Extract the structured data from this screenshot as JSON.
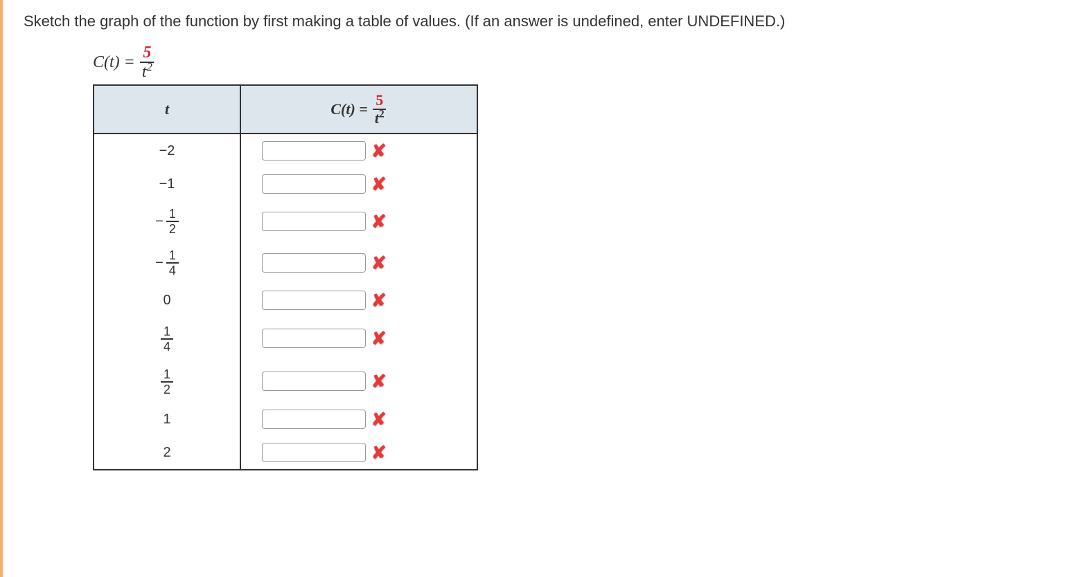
{
  "prompt": "Sketch the graph of the function by first making a table of values. (If an answer is undefined, enter UNDEFINED.)",
  "equation": {
    "lhs": "C(t) =",
    "num": "5",
    "den_base": "t",
    "den_exp": "2"
  },
  "headers": {
    "t": "t",
    "ct_lhs": "C(t) =",
    "ct_num": "5",
    "ct_den_base": "t",
    "ct_den_exp": "2"
  },
  "rows": [
    {
      "t_display": "-2",
      "t_is_frac": false,
      "value": "",
      "mark": "wrong"
    },
    {
      "t_display": "-1",
      "t_is_frac": false,
      "value": "",
      "mark": "wrong"
    },
    {
      "t_num": "1",
      "t_den": "2",
      "t_sign": "−",
      "t_is_frac": true,
      "value": "",
      "mark": "wrong"
    },
    {
      "t_num": "1",
      "t_den": "4",
      "t_sign": "−",
      "t_is_frac": true,
      "value": "",
      "mark": "wrong"
    },
    {
      "t_display": "0",
      "t_is_frac": false,
      "value": "",
      "mark": "wrong"
    },
    {
      "t_num": "1",
      "t_den": "4",
      "t_sign": "",
      "t_is_frac": true,
      "value": "",
      "mark": "wrong"
    },
    {
      "t_num": "1",
      "t_den": "2",
      "t_sign": "",
      "t_is_frac": true,
      "value": "",
      "mark": "wrong"
    },
    {
      "t_display": "1",
      "t_is_frac": false,
      "value": "",
      "mark": "wrong"
    },
    {
      "t_display": "2",
      "t_is_frac": false,
      "value": "",
      "mark": "wrong"
    }
  ],
  "icons": {
    "wrong_glyph": "✘"
  }
}
